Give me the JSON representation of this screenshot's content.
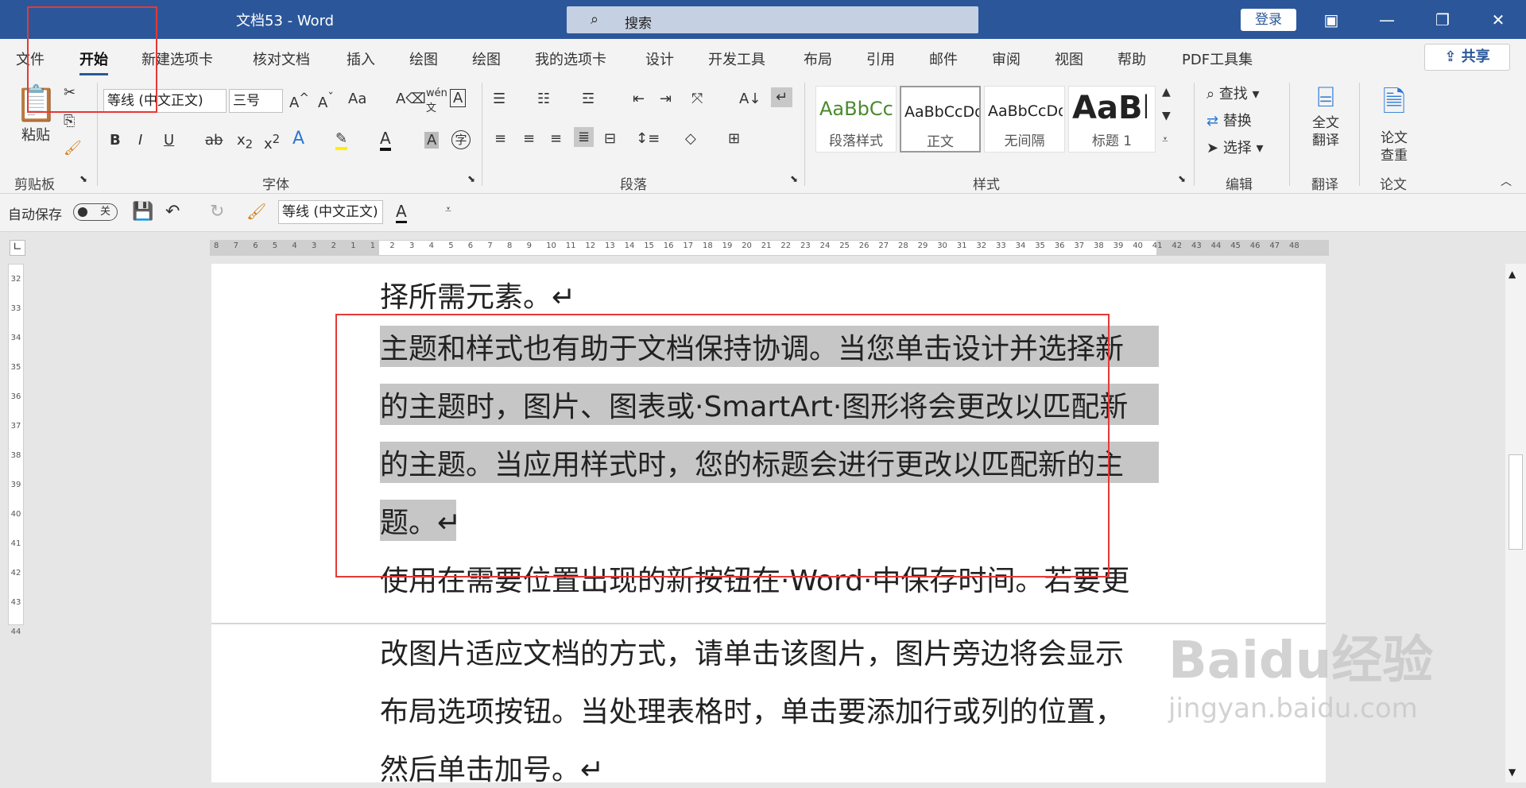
{
  "window": {
    "title": "文档53 - Word",
    "search_icon": "magnifier-icon",
    "search_placeholder": "搜索",
    "login": "登录"
  },
  "tabs": [
    "文件",
    "开始",
    "新建选项卡",
    "核对文档",
    "插入",
    "绘图",
    "绘图",
    "我的选项卡",
    "设计",
    "开发工具",
    "布局",
    "引用",
    "邮件",
    "审阅",
    "视图",
    "帮助",
    "PDF工具集"
  ],
  "share": "共享",
  "ribbon": {
    "clipboard": {
      "paste": "粘贴",
      "label": "剪贴板"
    },
    "font": {
      "name": "等线 (中文正文)",
      "size": "三号",
      "label": "字体"
    },
    "paragraph": {
      "label": "段落"
    },
    "styles": {
      "items": [
        {
          "preview": "AaBbCc",
          "name": "段落样式"
        },
        {
          "preview": "AaBbCcDd",
          "name": "正文"
        },
        {
          "preview": "AaBbCcDd",
          "name": "无间隔"
        },
        {
          "preview": "AaBb",
          "name": "标题 1"
        }
      ],
      "label": "样式"
    },
    "editing": {
      "find": "查找",
      "replace": "替换",
      "select": "选择",
      "label": "编辑"
    },
    "translate": {
      "button": "全文\n翻译",
      "label": "翻译"
    },
    "paper": {
      "button": "论文\n查重",
      "label": "论文"
    }
  },
  "qat": {
    "autosave": "自动保存",
    "toggle": "关",
    "font": "等线 (中文正文)"
  },
  "ruler": {
    "marks": [
      "8",
      "7",
      "6",
      "5",
      "4",
      "3",
      "2",
      "1",
      "1",
      "2",
      "3",
      "4",
      "5",
      "6",
      "7",
      "8",
      "9",
      "10",
      "11",
      "12",
      "13",
      "14",
      "15",
      "16",
      "17",
      "18",
      "19",
      "20",
      "21",
      "22",
      "23",
      "24",
      "25",
      "26",
      "27",
      "28",
      "29",
      "30",
      "31",
      "32",
      "33",
      "34",
      "35",
      "36",
      "37",
      "38",
      "39",
      "40",
      "41",
      "42",
      "43",
      "44",
      "45",
      "46",
      "47",
      "48"
    ],
    "vmarks": [
      "32",
      "33",
      "34",
      "35",
      "36",
      "37",
      "38",
      "39",
      "40",
      "41",
      "42",
      "43",
      "44"
    ]
  },
  "document": {
    "lines": [
      "择所需元素。↵",
      "主题和样式也有助于文档保持协调。当您单击设计并选择新",
      "的主题时，图片、图表或·SmartArt·图形将会更改以匹配新",
      "的主题。当应用样式时，您的标题会进行更改以匹配新的主",
      "题。↵",
      "使用在需要位置出现的新按钮在·Word·中保存时间。若要更",
      "改图片适应文档的方式，请单击该图片，图片旁边将会显示",
      "布局选项按钮。当处理表格时，单击要添加行或列的位置，",
      "然后单击加号。↵"
    ]
  },
  "watermark": "Baidu经验 jingyan.baidu.com"
}
